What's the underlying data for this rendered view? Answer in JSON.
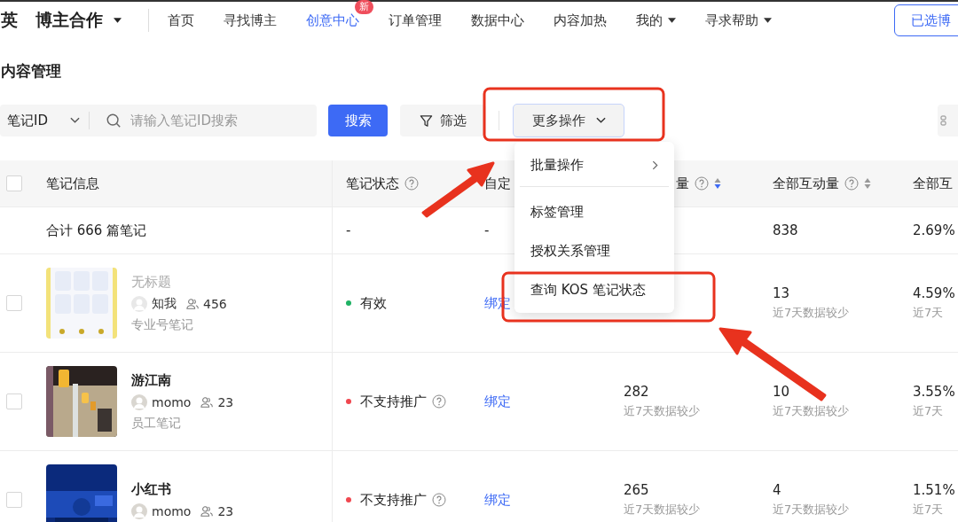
{
  "nav": {
    "brand": "英",
    "product": "博主合作",
    "items": [
      {
        "label": "首页",
        "selected": false
      },
      {
        "label": "寻找博主",
        "selected": false
      },
      {
        "label": "创意中心",
        "selected": true,
        "badge": "新"
      },
      {
        "label": "订单管理",
        "selected": false
      },
      {
        "label": "数据中心",
        "selected": false
      },
      {
        "label": "内容加热",
        "selected": false
      },
      {
        "label": "我的",
        "selected": false,
        "dropdown": true
      },
      {
        "label": "寻求帮助",
        "selected": false,
        "dropdown": true
      }
    ],
    "action": "已选博"
  },
  "page_title": "内容管理",
  "toolbar": {
    "search_type": "笔记ID",
    "placeholder": "请输入笔记ID搜索",
    "search_button": "搜索",
    "filter_button": "筛选",
    "more_button": "更多操作"
  },
  "menu": {
    "items": [
      {
        "label": "批量操作",
        "submenu": true
      },
      {
        "label": "标签管理",
        "submenu": false
      },
      {
        "label": "授权关系管理",
        "submenu": false
      },
      {
        "label": "查询 KOS 笔记状态",
        "submenu": false
      }
    ]
  },
  "table": {
    "all_checked": false,
    "columns": [
      {
        "label": "笔记信息",
        "help": false,
        "sortable": false
      },
      {
        "label": "笔记状态",
        "help": true,
        "sortable": false
      },
      {
        "label": "自定",
        "help": false,
        "sortable": false
      },
      {
        "label": "量",
        "help": true,
        "sortable": true,
        "sort_desc": true
      },
      {
        "label": "全部互动量",
        "help": true,
        "sortable": true,
        "sort_desc": false
      },
      {
        "label": "全部互",
        "help": false,
        "sortable": false
      }
    ],
    "total": {
      "label": "合计 666 篇笔记",
      "status": "-",
      "custom": "-",
      "interactions": "838",
      "rate": "2.69%"
    },
    "rows": [
      {
        "checked": false,
        "title": "无标题",
        "untitled": true,
        "author": "知我",
        "followers": "456",
        "type": "专业号笔记",
        "status": "有效",
        "color": "#1fb264",
        "status_help": false,
        "action": "绑定",
        "interactions": "13",
        "interactions_note": "近7天数据较少",
        "rate": "4.59%",
        "rate_note": "近7天"
      },
      {
        "checked": false,
        "title": "游江南",
        "untitled": false,
        "author": "momo",
        "followers": "23",
        "type": "员工笔记",
        "status": "不支持推广",
        "color": "#f0474f",
        "status_help": true,
        "action": "绑定",
        "reads": "282",
        "reads_note": "近7天数据较少",
        "interactions": "10",
        "interactions_note": "近7天数据较少",
        "rate": "3.55%",
        "rate_note": "近7天"
      },
      {
        "checked": false,
        "title": "小红书",
        "untitled": false,
        "author": "momo",
        "followers": "23",
        "status": "不支持推广",
        "color": "#f0474f",
        "status_help": true,
        "action": "绑定",
        "reads": "265",
        "reads_note": "近7天数据较少",
        "interactions": "4",
        "interactions_note": "近7天数据较少",
        "rate": "1.51%",
        "rate_note": "近7天"
      }
    ]
  }
}
